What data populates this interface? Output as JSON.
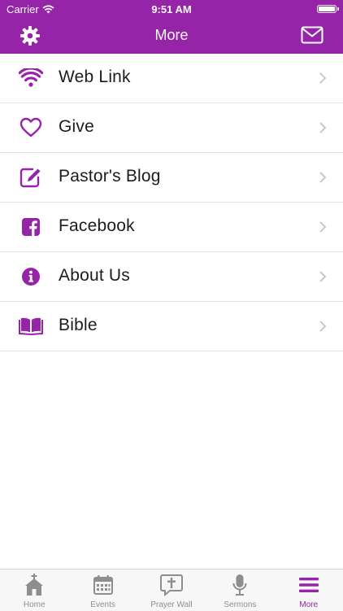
{
  "status_bar": {
    "carrier": "Carrier",
    "time": "9:51 AM"
  },
  "nav": {
    "title": "More",
    "left_icon": "gear-icon",
    "right_icon": "envelope-icon"
  },
  "menu": {
    "items": [
      {
        "label": "Web Link",
        "icon": "wifi-icon"
      },
      {
        "label": "Give",
        "icon": "heart-icon"
      },
      {
        "label": "Pastor's Blog",
        "icon": "edit-icon"
      },
      {
        "label": "Facebook",
        "icon": "facebook-icon"
      },
      {
        "label": "About Us",
        "icon": "info-icon"
      },
      {
        "label": "Bible",
        "icon": "book-icon"
      }
    ]
  },
  "tabs": [
    {
      "label": "Home",
      "icon": "church-icon",
      "active": false
    },
    {
      "label": "Events",
      "icon": "calendar-icon",
      "active": false
    },
    {
      "label": "Prayer Wall",
      "icon": "cross-bubble-icon",
      "active": false
    },
    {
      "label": "Sermons",
      "icon": "microphone-icon",
      "active": false
    },
    {
      "label": "More",
      "icon": "menu-icon",
      "active": true
    }
  ],
  "colors": {
    "accent": "#9624a8",
    "tab_inactive": "#8e8e8e",
    "divider": "#e2e2e2"
  }
}
